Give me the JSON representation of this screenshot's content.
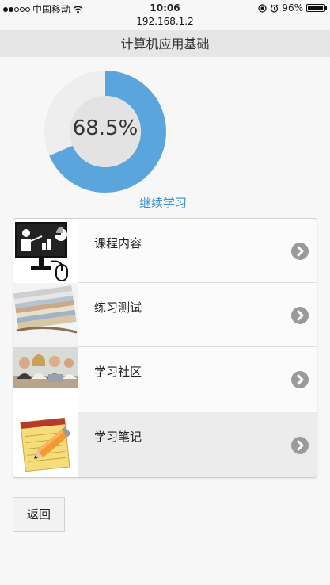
{
  "status_bar": {
    "carrier": "中国移动",
    "time": "10:06",
    "battery": "96%",
    "signal_bars_filled": 2,
    "signal_bars_total": 5
  },
  "url": "192.168.1.2",
  "page_title": "计算机应用基础",
  "progress": {
    "value": 0.685,
    "label": "68.5%",
    "track_color": "#eeeeee",
    "fill_color": "#5aa6dc",
    "center_color": "#e3e3e3"
  },
  "continue_label": "继续学习",
  "menu": {
    "items": [
      {
        "label": "课程内容",
        "icon": "presentation-icon"
      },
      {
        "label": "练习测试",
        "icon": "notebook-stack-icon"
      },
      {
        "label": "学习社区",
        "icon": "group-photo-icon"
      },
      {
        "label": "学习笔记",
        "icon": "notepad-pencil-icon"
      }
    ]
  },
  "back_label": "返回"
}
